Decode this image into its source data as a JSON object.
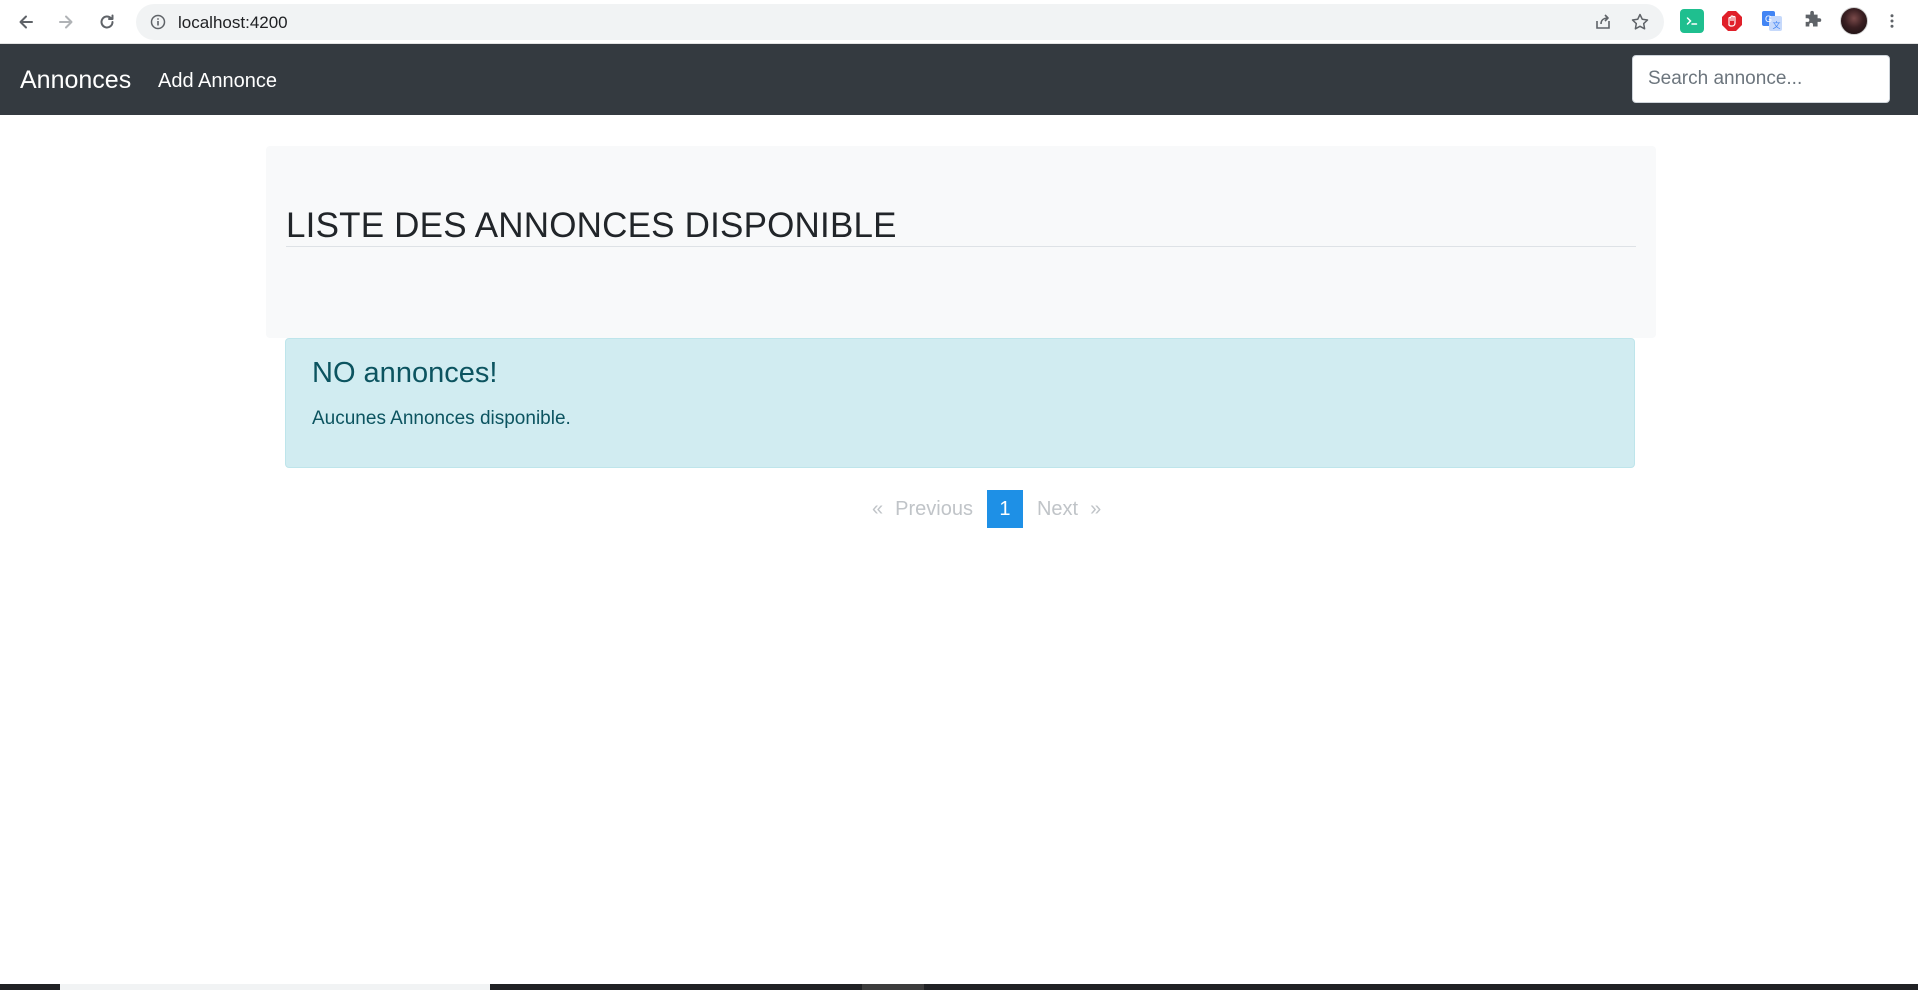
{
  "browser": {
    "url": "localhost:4200",
    "icons": [
      "back-arrow-icon",
      "forward-arrow-icon",
      "reload-icon",
      "info-icon",
      "share-icon",
      "star-icon",
      "terminal-extension-icon",
      "shield-extension-icon",
      "translate-extension-icon",
      "puzzle-icon",
      "avatar",
      "menu-dots-icon"
    ]
  },
  "navbar": {
    "brand": "Annonces",
    "add_link": "Add Annonce",
    "search_placeholder": "Search annonce...",
    "background": "#343a40"
  },
  "main": {
    "title": "LISTE DES ANNONCES DISPONIBLE",
    "alert": {
      "heading": "NO annonces!",
      "text": "Aucunes Annonces disponible.",
      "background": "#d1ecf1",
      "color": "#0c5460"
    },
    "pagination": {
      "first": "«",
      "previous": "Previous",
      "current_page": "1",
      "next": "Next",
      "last": "»",
      "active_color": "#1e90e6"
    }
  }
}
